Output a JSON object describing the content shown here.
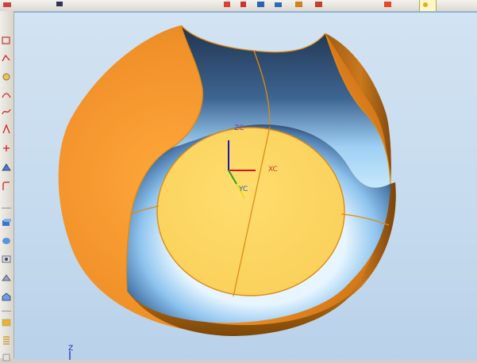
{
  "viewport": {
    "axis_labels": {
      "zc": "ZC",
      "xc": "XC",
      "yc": "YC"
    },
    "triad_label": "Z"
  },
  "colors": {
    "accent_orange": "#f7a234",
    "edge_orange": "#e08a10",
    "face_yellow": "#ffd966",
    "blue_surface": "#5b8fc4",
    "dark_blue": "#1f3550"
  },
  "toolbar": {
    "top_icons": [
      "arrow-icon",
      "gear-icon",
      "cube-icon",
      "cube-icon",
      "view-icon",
      "view-icon",
      "render-icon",
      "render-icon",
      "layer-icon",
      "snap-icon"
    ],
    "left_icons": [
      "sketch-icon",
      "curve-icon",
      "circle-icon",
      "arc-icon",
      "spline-icon",
      "spline-icon",
      "point-icon",
      "plane-icon",
      "edge-icon",
      "extrude-icon",
      "revolve-icon",
      "hole-icon",
      "feature-icon",
      "blend-icon",
      "shell-icon",
      "thread-icon"
    ]
  }
}
